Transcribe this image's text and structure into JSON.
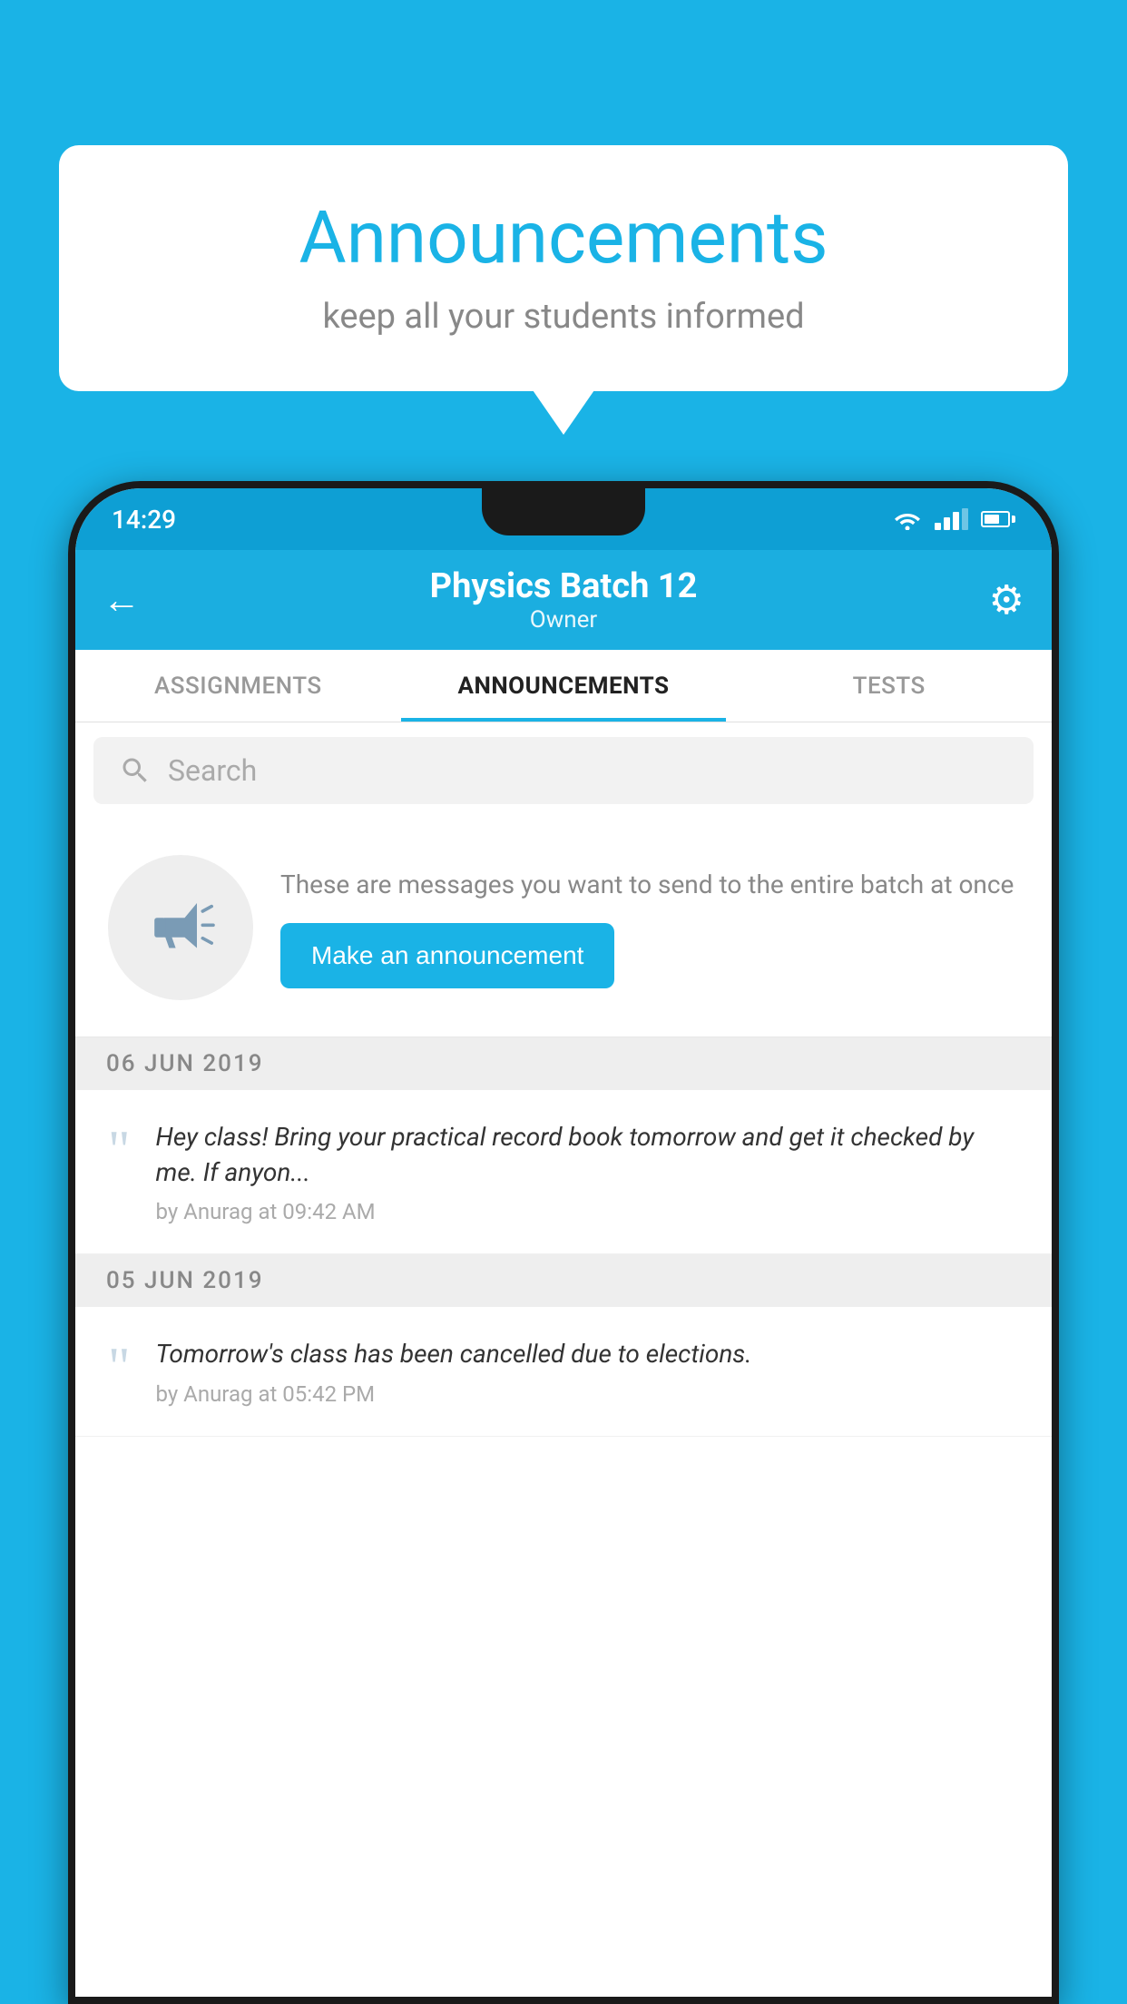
{
  "background_color": "#1ab3e6",
  "speech_bubble": {
    "title": "Announcements",
    "subtitle": "keep all your students informed"
  },
  "phone": {
    "status_bar": {
      "time": "14:29"
    },
    "top_bar": {
      "title": "Physics Batch 12",
      "subtitle": "Owner",
      "back_label": "←",
      "gear_label": "⚙"
    },
    "tabs": [
      {
        "label": "ASSIGNMENTS",
        "active": false
      },
      {
        "label": "ANNOUNCEMENTS",
        "active": true
      },
      {
        "label": "TESTS",
        "active": false
      }
    ],
    "search": {
      "placeholder": "Search"
    },
    "empty_state": {
      "description": "These are messages you want to send to the entire batch at once",
      "button_label": "Make an announcement"
    },
    "announcements": [
      {
        "date": "06  JUN  2019",
        "message": "Hey class! Bring your practical record book tomorrow and get it checked by me. If anyon...",
        "meta": "by Anurag at 09:42 AM"
      },
      {
        "date": "05  JUN  2019",
        "message": "Tomorrow's class has been cancelled due to elections.",
        "meta": "by Anurag at 05:42 PM"
      }
    ]
  }
}
